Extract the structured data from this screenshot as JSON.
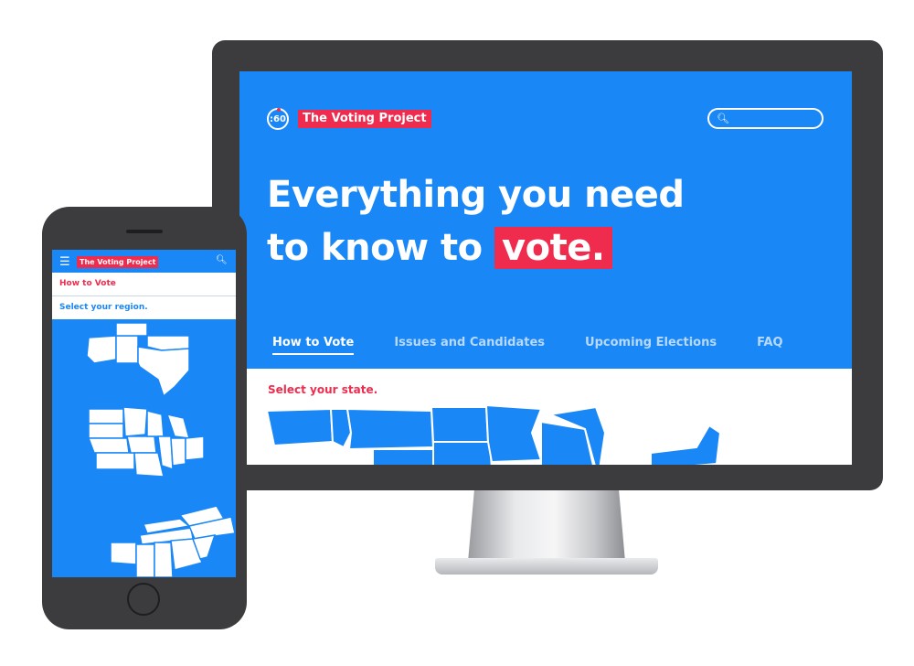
{
  "desktop": {
    "logo_badge": ":60",
    "brand": "The Voting Project",
    "search": {
      "icon": "search-icon",
      "placeholder": ""
    },
    "hero": {
      "line1": "Everything you need",
      "line2_prefix": "to know to",
      "highlight": "vote."
    },
    "tabs": [
      {
        "label": "How to Vote",
        "active": true
      },
      {
        "label": "Issues and Candidates",
        "active": false
      },
      {
        "label": "Upcoming Elections",
        "active": false
      },
      {
        "label": "FAQ",
        "active": false
      }
    ],
    "section_title": "Select your state."
  },
  "phone": {
    "menu_icon": "hamburger-icon",
    "brand": "The Voting Project",
    "search_icon": "search-icon",
    "row_active": "How to Vote",
    "row_prompt": "Select your region."
  },
  "colors": {
    "accent_blue": "#1a87f7",
    "brand_red": "#ef2c4e",
    "device_gray": "#3c3c3e"
  }
}
